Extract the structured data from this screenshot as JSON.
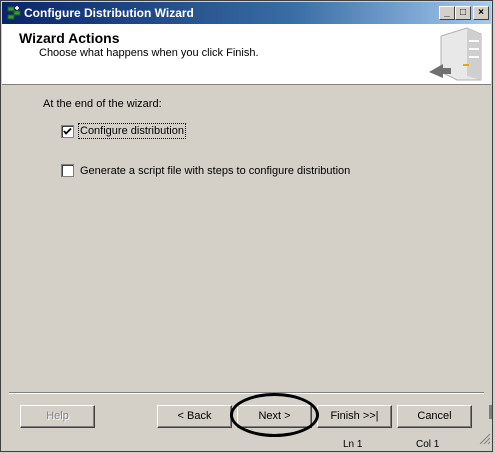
{
  "window": {
    "title": "Configure Distribution Wizard",
    "controls": {
      "minimize": "_",
      "maximize": "□",
      "close": "×"
    }
  },
  "header": {
    "title": "Wizard Actions",
    "subtitle": "Choose what happens when you click Finish."
  },
  "body": {
    "intro": "At the end of the wizard:",
    "options": [
      {
        "label": "Configure distribution",
        "checked": true
      },
      {
        "label": "Generate a script file with steps to configure distribution",
        "checked": false
      }
    ]
  },
  "buttons": {
    "help": "Help",
    "back": "< Back",
    "next": "Next >",
    "finish": "Finish >>|",
    "cancel": "Cancel"
  },
  "status": {
    "ln": "Ln 1",
    "col": "Col 1"
  }
}
